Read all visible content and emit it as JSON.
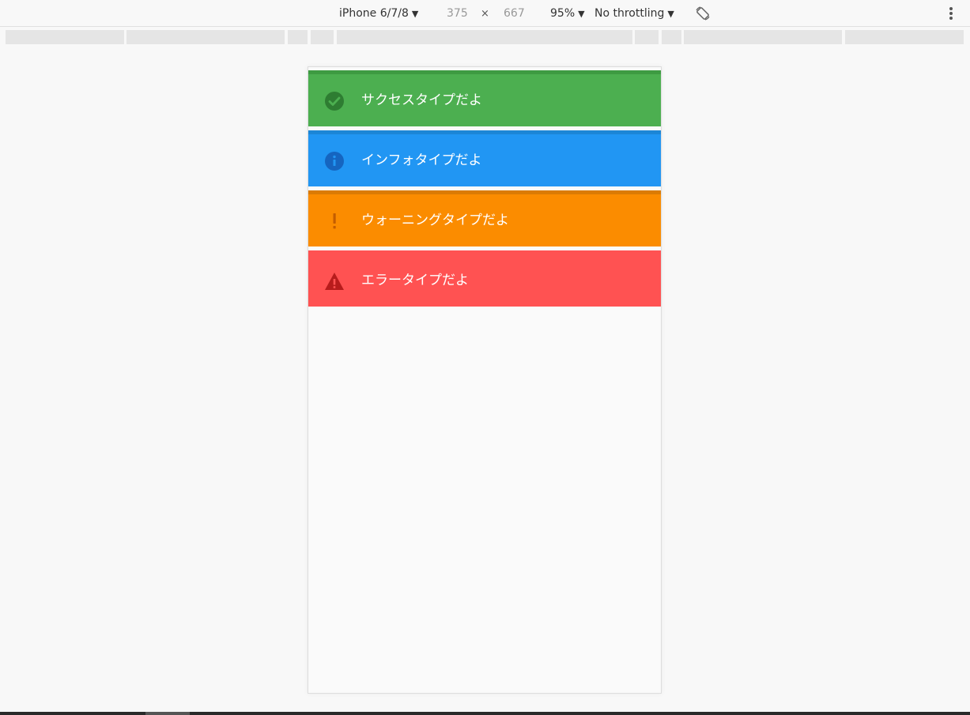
{
  "toolbar": {
    "device": "iPhone 6/7/8",
    "width": "375",
    "times": "×",
    "height": "667",
    "zoom": "95%",
    "throttling": "No throttling",
    "caret": "▼",
    "rotate_icon": "rotate-icon",
    "more_icon": "more-vertical-icon"
  },
  "alerts": [
    {
      "type": "success",
      "text": "サクセスタイプだよ",
      "icon": "check-circle-icon",
      "bg": "#4caf50",
      "border": "#3e9b42",
      "icon_color": "#2e7d32"
    },
    {
      "type": "info",
      "text": "インフォタイプだよ",
      "icon": "info-icon",
      "bg": "#2196f3",
      "border": "#1c86d6",
      "icon_color": "#1565c0"
    },
    {
      "type": "warning",
      "text": "ウォーニングタイプだよ",
      "icon": "exclamation-icon",
      "bg": "#fb8c00",
      "border": "#db7b04",
      "icon_color": "#c35d00"
    },
    {
      "type": "error",
      "text": "エラータイプだよ",
      "icon": "warning-triangle-icon",
      "bg": "#ff5252",
      "border": "#ff5252",
      "icon_color": "#b71c1c"
    }
  ]
}
